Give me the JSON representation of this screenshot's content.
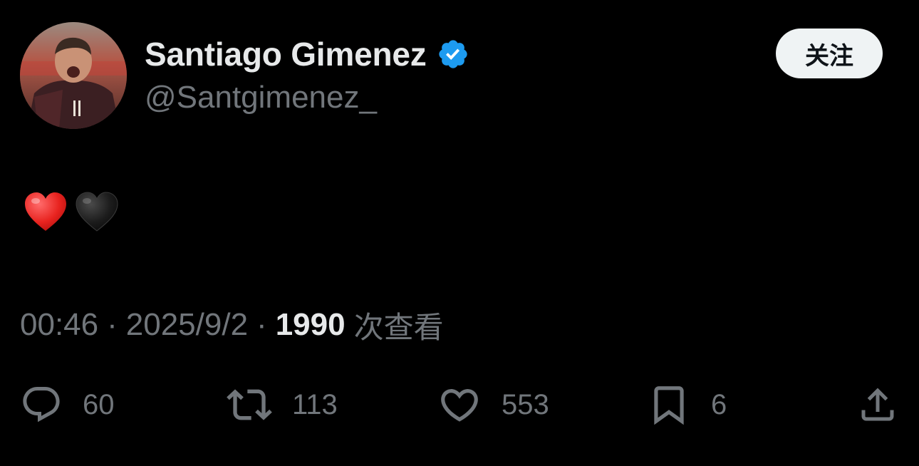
{
  "post": {
    "author": {
      "display_name": "Santiago Gimenez",
      "handle": "@Santgimenez_",
      "verified": true,
      "avatar_icon": "profile-photo"
    },
    "follow_button_label": "关注",
    "content_emojis": [
      "red-heart-emoji",
      "black-heart-emoji"
    ],
    "time": "00:46",
    "separator": "·",
    "date": "2025/9/2",
    "view_count": "1990",
    "views_label": "次查看"
  },
  "actions": {
    "replies": {
      "icon": "reply-icon",
      "count": "60"
    },
    "reposts": {
      "icon": "repost-icon",
      "count": "113"
    },
    "likes": {
      "icon": "like-icon",
      "count": "553"
    },
    "bookmarks": {
      "icon": "bookmark-icon",
      "count": "6"
    },
    "share": {
      "icon": "share-icon"
    }
  },
  "colors": {
    "background": "#000000",
    "primary_text": "#e7e9ea",
    "secondary_text": "#71767b",
    "verified_blue": "#1d9bf0",
    "follow_button_bg": "#eff3f4"
  }
}
